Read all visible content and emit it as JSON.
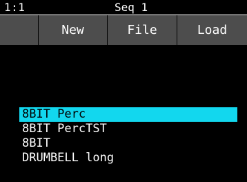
{
  "status": {
    "position": "1:1",
    "title": "Seq 1"
  },
  "menu": {
    "blank": "",
    "new": "New",
    "file": "File",
    "load": "Load"
  },
  "list": {
    "items": [
      "8BIT Perc",
      "8BIT PercTST",
      "8BIT",
      "DRUMBELL long"
    ],
    "selected_index": 0
  },
  "colors": {
    "background": "#000000",
    "menu_background": "#4d4d4d",
    "selection": "#12d7ee",
    "text": "#ffffff"
  }
}
